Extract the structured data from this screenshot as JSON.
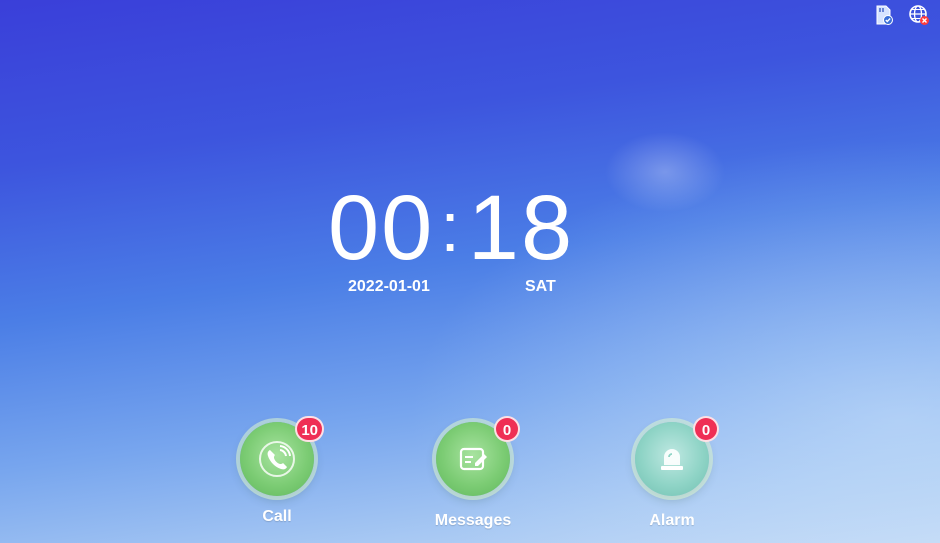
{
  "status_bar": {
    "icons": [
      "sd-card-check-icon",
      "network-error-icon"
    ],
    "colors": {
      "card": "#cfe0ff",
      "error": "#ff3b3b"
    }
  },
  "clock": {
    "hours": "00",
    "separator": ":",
    "minutes": "18",
    "date": "2022-01-01",
    "day": "SAT"
  },
  "apps": [
    {
      "label": "Call",
      "badge": "10",
      "icon": "phone-icon"
    },
    {
      "label": "Messages",
      "badge": "0",
      "icon": "message-edit-icon"
    },
    {
      "label": "Alarm",
      "badge": "0",
      "icon": "alarm-siren-icon"
    }
  ],
  "colors": {
    "badge": "#ef2f55",
    "app_green": "#7ccc74",
    "app_teal": "#8fd4c6",
    "bg_top": "#3a3fd9",
    "bg_bottom": "#c4daf6"
  }
}
